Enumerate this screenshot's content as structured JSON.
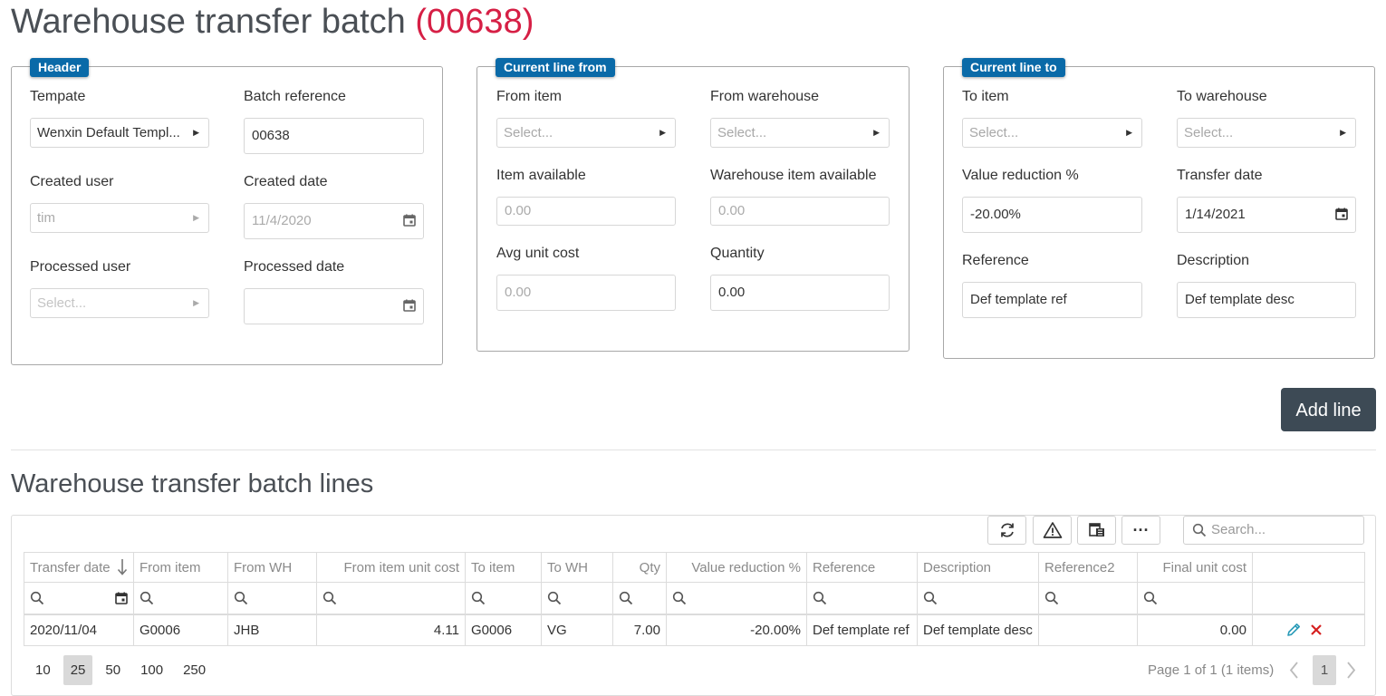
{
  "page": {
    "title": "Warehouse transfer batch",
    "batch_number": "(00638)"
  },
  "header_panel": {
    "badge": "Header",
    "template_label": "Tempate",
    "template_value": "Wenxin Default Templ...",
    "batch_reference_label": "Batch reference",
    "batch_reference_value": "00638",
    "created_user_label": "Created user",
    "created_user_value": "tim",
    "created_date_label": "Created date",
    "created_date_value": "11/4/2020",
    "processed_user_label": "Processed user",
    "processed_user_placeholder": "Select...",
    "processed_date_label": "Processed date",
    "processed_date_value": ""
  },
  "from_panel": {
    "badge": "Current line from",
    "from_item_label": "From item",
    "from_item_placeholder": "Select...",
    "from_warehouse_label": "From warehouse",
    "from_warehouse_placeholder": "Select...",
    "item_available_label": "Item available",
    "item_available_value": "0.00",
    "warehouse_item_available_label": "Warehouse item available",
    "warehouse_item_available_value": "0.00",
    "avg_unit_cost_label": "Avg unit cost",
    "avg_unit_cost_value": "0.00",
    "quantity_label": "Quantity",
    "quantity_value": "0.00"
  },
  "to_panel": {
    "badge": "Current line to",
    "to_item_label": "To item",
    "to_item_placeholder": "Select...",
    "to_warehouse_label": "To warehouse",
    "to_warehouse_placeholder": "Select...",
    "value_reduction_label": "Value reduction %",
    "value_reduction_value": "-20.00%",
    "transfer_date_label": "Transfer date",
    "transfer_date_value": "1/14/2021",
    "reference_label": "Reference",
    "reference_value": "Def template ref",
    "description_label": "Description",
    "description_value": "Def template desc"
  },
  "actions": {
    "add_line_label": "Add line"
  },
  "lines_section": {
    "title": "Warehouse transfer batch lines"
  },
  "grid": {
    "toolbar": {
      "refresh_icon": "refresh-icon",
      "warning_icon": "warning-icon",
      "export_icon": "export-icon",
      "more_label": "···",
      "search_placeholder": "Search..."
    },
    "columns": [
      "Transfer date",
      "From item",
      "From WH",
      "From item unit cost",
      "To item",
      "To WH",
      "Qty",
      "Value reduction %",
      "Reference",
      "Description",
      "Reference2",
      "Final unit cost",
      ""
    ],
    "rows": [
      {
        "transfer_date": "2020/11/04",
        "from_item": "G0006",
        "from_wh": "JHB",
        "from_item_unit_cost": "4.11",
        "to_item": "G0006",
        "to_wh": "VG",
        "qty": "7.00",
        "value_reduction": "-20.00%",
        "reference": "Def template ref",
        "description": "Def template desc",
        "reference2": "",
        "final_unit_cost": "0.00"
      }
    ],
    "pager": {
      "sizes": [
        "10",
        "25",
        "50",
        "100",
        "250"
      ],
      "active_size": "25",
      "info": "Page 1 of 1 (1 items)",
      "current_page": "1"
    }
  },
  "colors": {
    "batch_number": "#d61f45",
    "badge": "#0a6aa8",
    "add_line_button": "#3d4a55",
    "edit_icon": "#2a9bb8",
    "delete_icon": "#d61f1f"
  }
}
